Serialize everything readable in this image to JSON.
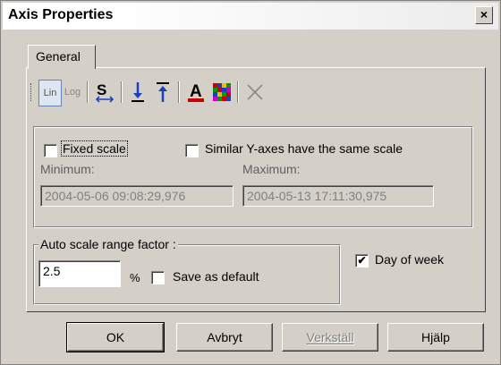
{
  "window": {
    "title": "Axis Properties",
    "close_glyph": "×"
  },
  "tabs": [
    {
      "label": "General"
    }
  ],
  "toolbar": {
    "lin_label": "Lin",
    "log_label": "Log",
    "icons": [
      "link-axes-icon",
      "align-bottom-icon",
      "align-top-icon",
      "font-color-icon",
      "color-palette-icon",
      "delete-icon"
    ]
  },
  "scale_group": {
    "fixed_scale_label": "Fixed scale",
    "fixed_scale_checked": false,
    "similar_label": "Similar Y-axes have the same scale",
    "similar_checked": false,
    "minimum_label": "Minimum:",
    "minimum_value": "2004-05-06 09:08:29,976",
    "maximum_label": "Maximum:",
    "maximum_value": "2004-05-13 17:11:30,975"
  },
  "auto_group": {
    "label": "Auto scale range factor :",
    "value": "2.5",
    "unit": "%",
    "save_default_label": "Save as default",
    "save_default_checked": false
  },
  "day_of_week": {
    "label": "Day of week",
    "checked": true
  },
  "buttons": {
    "ok": "OK",
    "cancel": "Avbryt",
    "apply": "Verkställ",
    "help": "Hjälp"
  },
  "colors": {
    "dialog_bg": "#d4d0c8",
    "accent_blue": "#1a3fc0",
    "red": "#cc0000"
  }
}
